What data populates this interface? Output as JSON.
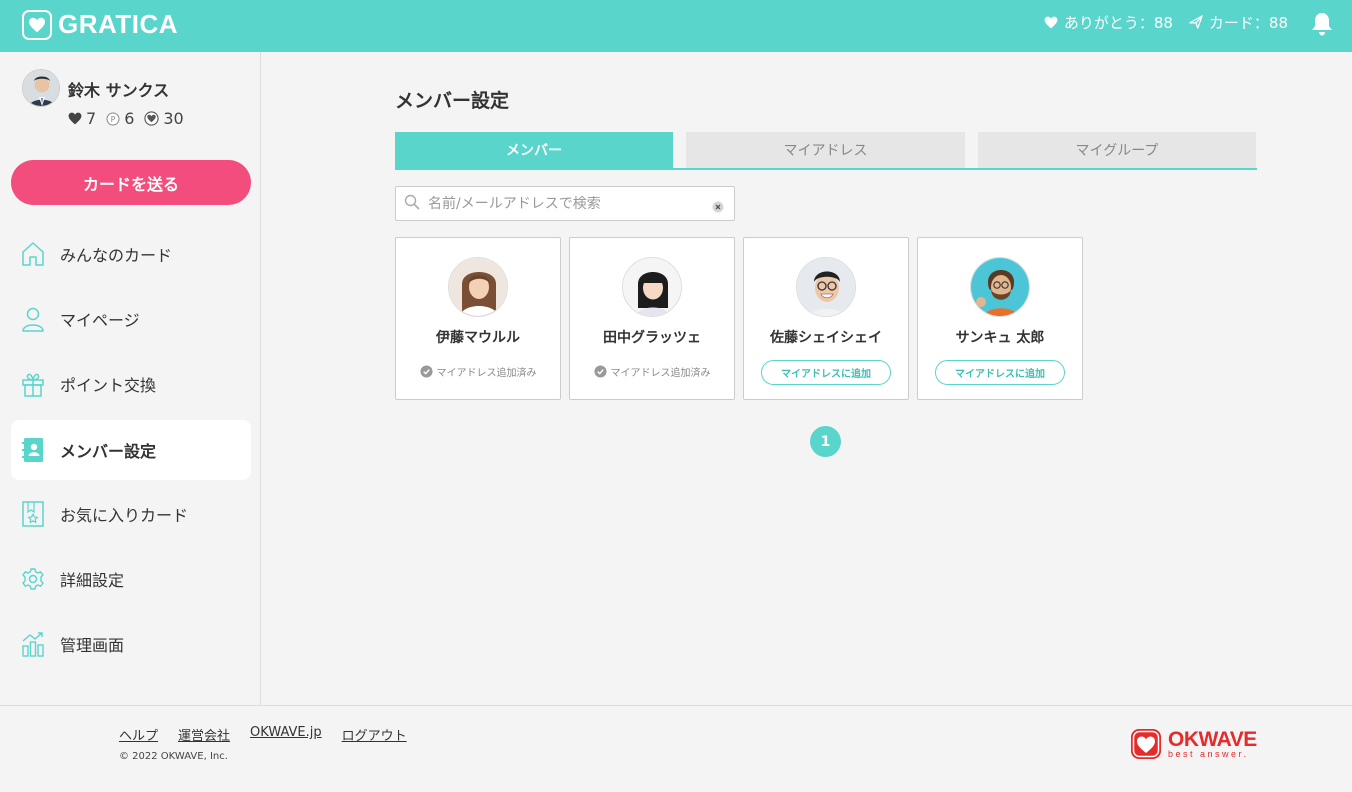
{
  "header": {
    "logo_text": "GRATICA",
    "thanks_label": "ありがとう：88",
    "cards_label": "カード：88"
  },
  "user": {
    "name": "鈴木 サンクス",
    "hearts": "7",
    "points": "6",
    "badges": "30"
  },
  "sidebar": {
    "send_button": "カードを送る",
    "items": [
      {
        "label": "みんなのカード",
        "icon": "home-icon"
      },
      {
        "label": "マイページ",
        "icon": "person-icon"
      },
      {
        "label": "ポイント交換",
        "icon": "gift-icon"
      },
      {
        "label": "メンバー設定",
        "icon": "member-book-icon",
        "active": true
      },
      {
        "label": "お気に入りカード",
        "icon": "bookmark-star-icon"
      },
      {
        "label": "詳細設定",
        "icon": "gear-icon"
      },
      {
        "label": "管理画面",
        "icon": "chart-icon"
      }
    ]
  },
  "main": {
    "title": "メンバー設定",
    "tabs": [
      {
        "label": "メンバー",
        "active": true
      },
      {
        "label": "マイアドレス"
      },
      {
        "label": "マイグループ"
      }
    ],
    "search": {
      "placeholder": "名前/メールアドレスで検索",
      "value": ""
    },
    "members": [
      {
        "name": "伊藤マウルル",
        "status": "マイアドレス追加済み"
      },
      {
        "name": "田中グラッツェ",
        "status": "マイアドレス追加済み"
      },
      {
        "name": "佐藤シェイシェイ",
        "action": "マイアドレスに追加"
      },
      {
        "name": "サンキュ 太郎",
        "action": "マイアドレスに追加"
      }
    ],
    "page": "1"
  },
  "footer": {
    "links": [
      "ヘルプ",
      "運営会社",
      "OKWAVE.jp",
      "ログアウト"
    ],
    "copyright": "© 2022 OKWAVE, Inc.",
    "brand": "OKWAVE",
    "brand_sub": "best answer."
  },
  "colors": {
    "accent": "#5ad5cc",
    "send_button": "#f24d7c",
    "brand_red": "#e52b2b"
  }
}
